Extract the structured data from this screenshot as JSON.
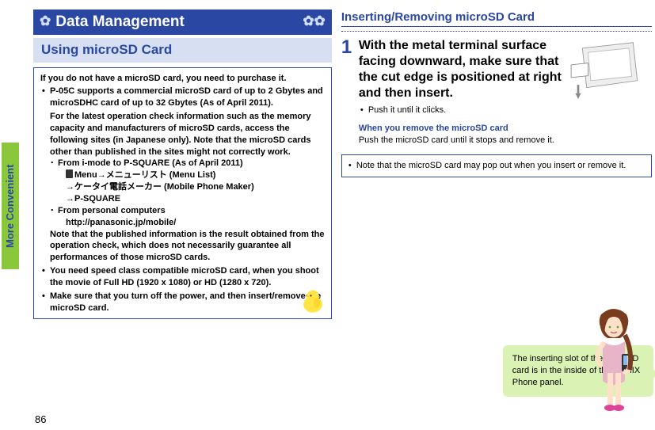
{
  "sideTab": "More Convenient",
  "pageNumber": "86",
  "chapterTitle": "Data Management",
  "sectionTitle": "Using microSD Card",
  "infoLead": "If you do not have a microSD card, you need to purchase it.",
  "bullet1": "P-05C supports a commercial microSD card of up to 2 Gbytes and microSDHC card of up to 32 Gbytes (As of April 2011).",
  "bullet1para": "For the latest operation check information such as the memory capacity and manufacturers of microSD cards, access the following sites (in Japanese only). Note that the microSD cards other than published in the sites might not correctly work.",
  "dash1": "From i-mode to P-SQUARE (As of April 2011)",
  "dash1a": "Menu→メニューリスト (Menu List)",
  "dash1b": "→ケータイ電話メーカー (Mobile Phone Maker)",
  "dash1c": "→P-SQUARE",
  "dash2": "From personal computers",
  "dash2a": "http://panasonic.jp/mobile/",
  "dashNote": "Note that the published information is the result obtained from the operation check, which does not necessarily guarantee all performances of those microSD cards.",
  "bullet2": "You need speed class compatible microSD card, when you shoot the movie of Full HD (1920 x 1080) or HD (1280 x 720).",
  "bullet3": "Make sure that you turn off the power, and then insert/remove the microSD card.",
  "stepHeading": "Inserting/Removing microSD Card",
  "step1num": "1",
  "step1text": "With the metal terminal surface facing downward, make sure that the cut edge is positioned at right and then insert.",
  "step1sub": "Push it until it clicks.",
  "removeHead": "When you remove the microSD card",
  "removeBody": "Push the microSD card until it stops and remove it.",
  "noteText": "Note that the microSD card may pop out when you insert or remove it.",
  "speechText": "The inserting slot of the microSD card is in the inside of the LUMIX Phone panel."
}
